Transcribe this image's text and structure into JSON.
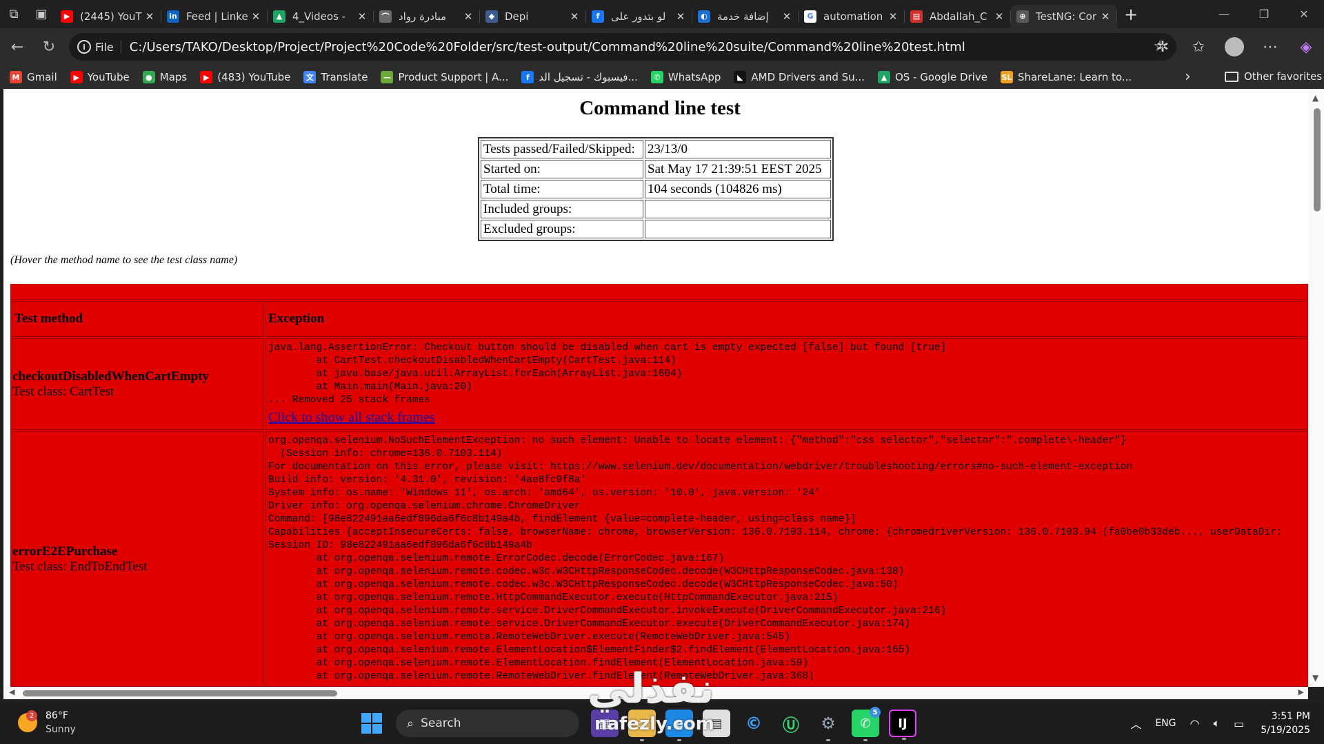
{
  "tabs": [
    {
      "title": "(2445) YouT",
      "icon": "youtube-icon",
      "color": "#ff0000",
      "glyph": "▶"
    },
    {
      "title": "Feed | Linke",
      "icon": "linkedin-icon",
      "color": "#0a66c2",
      "glyph": "in"
    },
    {
      "title": "4_Videos -",
      "icon": "google-drive-icon",
      "color": "#1fa463",
      "glyph": "▲"
    },
    {
      "title": "مبادرة رواد",
      "icon": "rowad-icon",
      "color": "#6b6b6b",
      "glyph": "⌒"
    },
    {
      "title": "Depi",
      "icon": "depi-icon",
      "color": "#3b5d8f",
      "glyph": "◆"
    },
    {
      "title": "لو بتدور على",
      "icon": "facebook-icon",
      "color": "#1877f2",
      "glyph": "f"
    },
    {
      "title": "إضافة خدمة",
      "icon": "service-icon",
      "color": "#1c6fd6",
      "glyph": "◐"
    },
    {
      "title": "automation",
      "icon": "google-icon",
      "color": "#ffffff",
      "glyph": "G"
    },
    {
      "title": "Abdallah_C",
      "icon": "pdf-icon",
      "color": "#d32f2f",
      "glyph": "▤"
    },
    {
      "title": "TestNG: Cor",
      "icon": "globe-icon",
      "color": "#5a5a5a",
      "glyph": "⊕",
      "active": true
    }
  ],
  "address": {
    "scheme_label": "File",
    "url": "C:/Users/TAKO/Desktop/Project/Project%20Code%20Folder/src/test-output/Command%20line%20suite/Command%20line%20test.html"
  },
  "favorites": [
    {
      "label": "Gmail",
      "icon": "gmail-icon",
      "color": "#ea4335",
      "glyph": "M"
    },
    {
      "label": "YouTube",
      "icon": "youtube-icon",
      "color": "#ff0000",
      "glyph": "▶"
    },
    {
      "label": "Maps",
      "icon": "maps-icon",
      "color": "#34a853",
      "glyph": "●"
    },
    {
      "label": "(483) YouTube",
      "icon": "youtube-icon",
      "color": "#ff0000",
      "glyph": "▶"
    },
    {
      "label": "Translate",
      "icon": "translate-icon",
      "color": "#4285f4",
      "glyph": "文"
    },
    {
      "label": "Product Support | A...",
      "icon": "product-support-icon",
      "color": "#6fa83a",
      "glyph": "—"
    },
    {
      "label": "فيسبوك - تسجيل الد...",
      "icon": "facebook-icon",
      "color": "#1877f2",
      "glyph": "f"
    },
    {
      "label": "WhatsApp",
      "icon": "whatsapp-icon",
      "color": "#25d366",
      "glyph": "✆"
    },
    {
      "label": "AMD Drivers and Su...",
      "icon": "amd-icon",
      "color": "#111111",
      "glyph": "◣"
    },
    {
      "label": "OS - Google Drive",
      "icon": "google-drive-icon",
      "color": "#1fa463",
      "glyph": "▲"
    },
    {
      "label": "ShareLane: Learn to...",
      "icon": "sharelane-icon",
      "color": "#f0a020",
      "glyph": "SL"
    }
  ],
  "favorites_other": "Other favorites",
  "page": {
    "title": "Command line test",
    "summary": [
      {
        "label": "Tests passed/Failed/Skipped:",
        "value": "23/13/0"
      },
      {
        "label": "Started on:",
        "value": "Sat May 17 21:39:51 EEST 2025"
      },
      {
        "label": "Total time:",
        "value": "104 seconds (104826 ms)"
      },
      {
        "label": "Included groups:",
        "value": ""
      },
      {
        "label": "Excluded groups:",
        "value": ""
      }
    ],
    "hover_note": "(Hover the method name to see the test class name)",
    "table_headers": {
      "method": "Test method",
      "exception": "Exception"
    },
    "failures": [
      {
        "method": "checkoutDisabledWhenCartEmpty",
        "test_class": "Test class: CartTest",
        "exception": "java.lang.AssertionError: Checkout button should be disabled when cart is empty expected [false] but found [true]\n\tat CartTest.checkoutDisabledWhenCartEmpty(CartTest.java:114)\n\tat java.base/java.util.ArrayList.forEach(ArrayList.java:1604)\n\tat Main.main(Main.java:20)\n... Removed 25 stack frames",
        "link": "Click to show all stack frames"
      },
      {
        "method": "errorE2EPurchase",
        "test_class": "Test class: EndToEndTest",
        "exception": "org.openqa.selenium.NoSuchElementException: no such element: Unable to locate element: {\"method\":\"css selector\",\"selector\":\".complete\\-header\"}\n  (Session info: chrome=136.0.7103.114)\nFor documentation on this error, please visit: https://www.selenium.dev/documentation/webdriver/troubleshooting/errors#no-such-element-exception\nBuild info: version: '4.31.0', revision: '4ae8fc9f8a'\nSystem info: os.name: 'Windows 11', os.arch: 'amd64', os.version: '10.0', java.version: '24'\nDriver info: org.openqa.selenium.chrome.ChromeDriver\nCommand: [98e822491aa6edf896da6f6c8b149a4b, findElement {value=complete-header, using=class name}]\nCapabilities {acceptInsecureCerts: false, browserName: chrome, browserVersion: 136.0.7103.114, chrome: {chromedriverVersion: 136.0.7103.94 (fa0be0b33deb..., userDataDir:\nSession ID: 98e822491aa6edf896da6f6c8b149a4b\n\tat org.openqa.selenium.remote.ErrorCodec.decode(ErrorCodec.java:167)\n\tat org.openqa.selenium.remote.codec.w3c.W3CHttpResponseCodec.decode(W3CHttpResponseCodec.java:138)\n\tat org.openqa.selenium.remote.codec.w3c.W3CHttpResponseCodec.decode(W3CHttpResponseCodec.java:50)\n\tat org.openqa.selenium.remote.HttpCommandExecutor.execute(HttpCommandExecutor.java:215)\n\tat org.openqa.selenium.remote.service.DriverCommandExecutor.invokeExecute(DriverCommandExecutor.java:216)\n\tat org.openqa.selenium.remote.service.DriverCommandExecutor.execute(DriverCommandExecutor.java:174)\n\tat org.openqa.selenium.remote.RemoteWebDriver.execute(RemoteWebDriver.java:545)\n\tat org.openqa.selenium.remote.ElementLocation$ElementFinder$2.findElement(ElementLocation.java:165)\n\tat org.openqa.selenium.remote.ElementLocation.findElement(ElementLocation.java:59)\n\tat org.openqa.selenium.remote.RemoteWebDriver.findElement(RemoteWebDriver.java:368)",
        "link": ""
      }
    ]
  },
  "taskbar": {
    "weather_temp": "86°F",
    "weather_cond": "Sunny",
    "weather_badge": "2",
    "search_label": "Search",
    "whatsapp_badge": "5",
    "lang": "ENG",
    "time": "3:51 PM",
    "date": "5/19/2025"
  },
  "watermark": {
    "arabic": "نفذلي",
    "latin": "nafezly.com"
  },
  "colors": {
    "failure_bg": "#e00000",
    "link": "#1a0dab",
    "chrome_dark": "#202020"
  }
}
